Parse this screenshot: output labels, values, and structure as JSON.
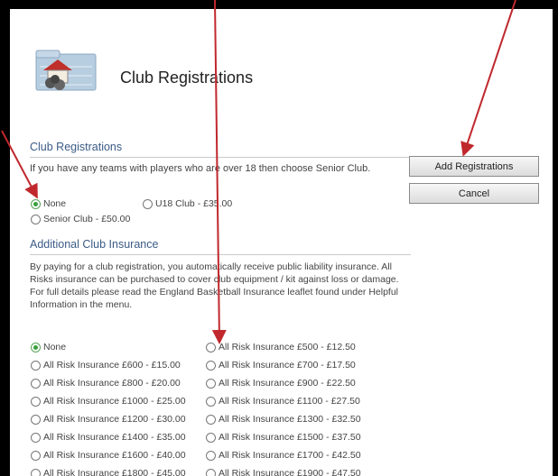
{
  "page": {
    "title": "Club Registrations"
  },
  "registration": {
    "heading": "Club Registrations",
    "instruction": "If you have any teams with players who are over 18 then choose Senior Club.",
    "options": [
      {
        "label": "None",
        "selected": true
      },
      {
        "label": "U18 Club - £35.00",
        "selected": false
      },
      {
        "label": "Senior Club - £50.00",
        "selected": false
      }
    ]
  },
  "insurance": {
    "heading": "Additional Club Insurance",
    "paragraph": "By paying for a club registration, you automatically receive public liability insurance. All Risks insurance can be purchased to cover club equipment / kit against loss or damage. For full details please read the England Basketball Insurance leaflet found under Helpful Information in the menu.",
    "options": [
      {
        "label": "None",
        "selected": true
      },
      {
        "label": "All Risk Insurance £500 - £12.50",
        "selected": false
      },
      {
        "label": "All Risk Insurance £600 - £15.00",
        "selected": false
      },
      {
        "label": "All Risk Insurance £700 - £17.50",
        "selected": false
      },
      {
        "label": "All Risk Insurance £800 - £20.00",
        "selected": false
      },
      {
        "label": "All Risk Insurance £900 - £22.50",
        "selected": false
      },
      {
        "label": "All Risk Insurance £1000 - £25.00",
        "selected": false
      },
      {
        "label": "All Risk Insurance £1100 - £27.50",
        "selected": false
      },
      {
        "label": "All Risk Insurance £1200 - £30.00",
        "selected": false
      },
      {
        "label": "All Risk Insurance £1300 - £32.50",
        "selected": false
      },
      {
        "label": "All Risk Insurance £1400 - £35.00",
        "selected": false
      },
      {
        "label": "All Risk Insurance £1500 - £37.50",
        "selected": false
      },
      {
        "label": "All Risk Insurance £1600 - £40.00",
        "selected": false
      },
      {
        "label": "All Risk Insurance £1700 - £42.50",
        "selected": false
      },
      {
        "label": "All Risk Insurance £1800 - £45.00",
        "selected": false
      },
      {
        "label": "All Risk Insurance £1900 - £47.50",
        "selected": false
      }
    ]
  },
  "actions": {
    "add_label": "Add Registrations",
    "cancel_label": "Cancel"
  },
  "annotations": {
    "arrow_color": "#c0282d"
  },
  "icons": [
    "club-house-icon",
    "radio-selected-icon",
    "radio-unselected-icon"
  ]
}
